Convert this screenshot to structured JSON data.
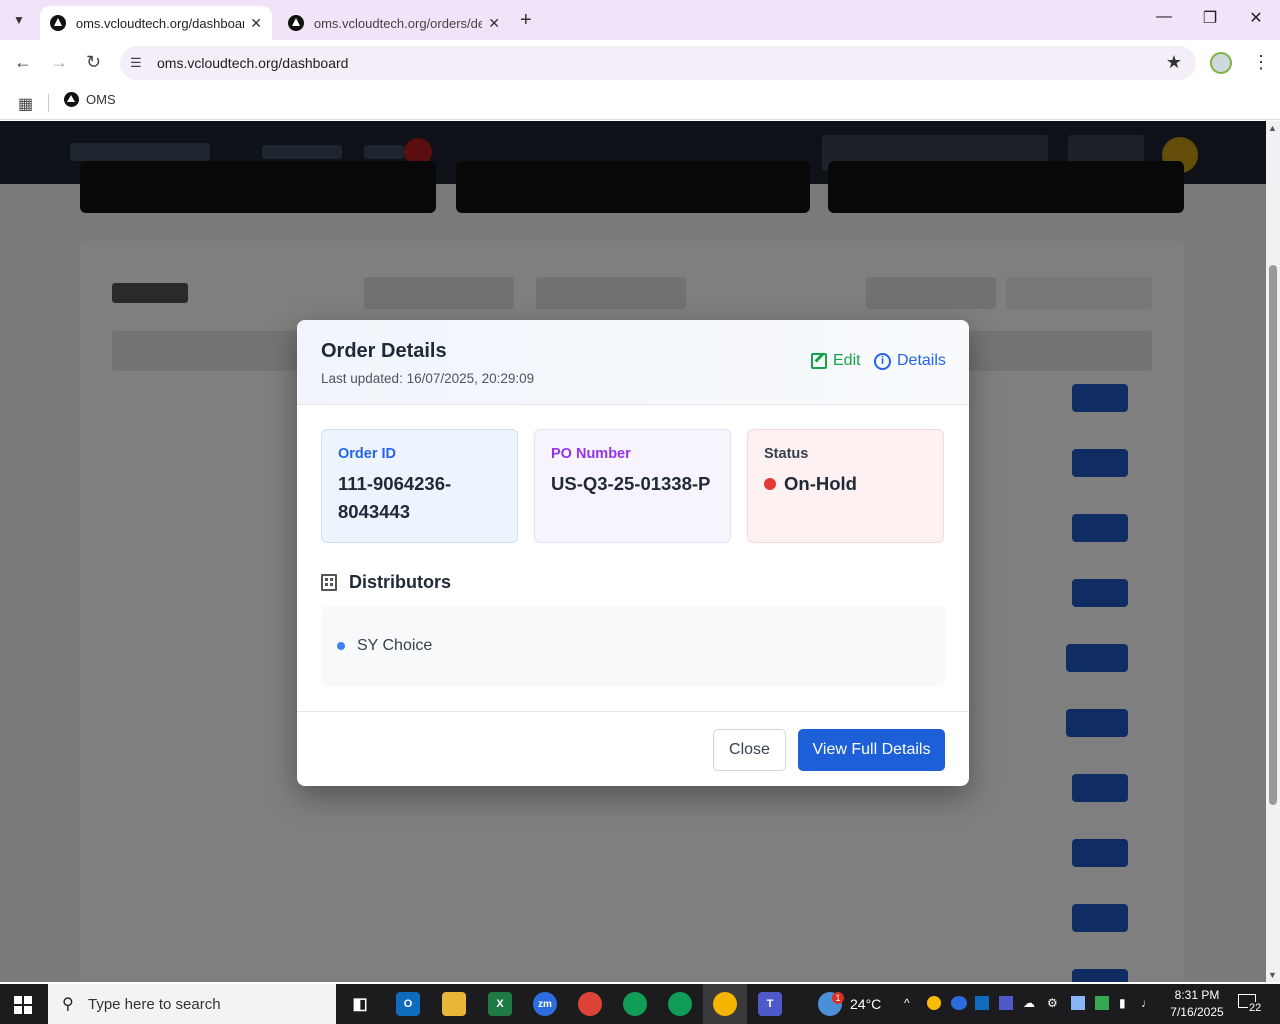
{
  "browser": {
    "tabs": [
      {
        "title": "oms.vcloudtech.org/dashboard",
        "active": true
      },
      {
        "title": "oms.vcloudtech.org/orders/det",
        "active": false
      }
    ],
    "url": "oms.vcloudtech.org/dashboard",
    "bookmarks": [
      {
        "label": "OMS"
      }
    ]
  },
  "modal": {
    "title": "Order Details",
    "last_updated": "Last updated: 16/07/2025, 20:29:09",
    "edit_label": "Edit",
    "details_label": "Details",
    "cards": {
      "order_id": {
        "label": "Order ID",
        "value": "111-9064236-8043443"
      },
      "po_number": {
        "label": "PO Number",
        "value": "US-Q3-25-01338-P"
      },
      "status": {
        "label": "Status",
        "value": "On-Hold",
        "color": "#e53935"
      }
    },
    "distributors": {
      "heading": "Distributors",
      "items": [
        "SY Choice"
      ]
    },
    "close_label": "Close",
    "view_full_label": "View Full Details"
  },
  "taskbar": {
    "search_placeholder": "Type here to search",
    "weather": "24°C",
    "weather_badge": "1",
    "time": "8:31 PM",
    "date": "7/16/2025",
    "notifications": "22"
  }
}
